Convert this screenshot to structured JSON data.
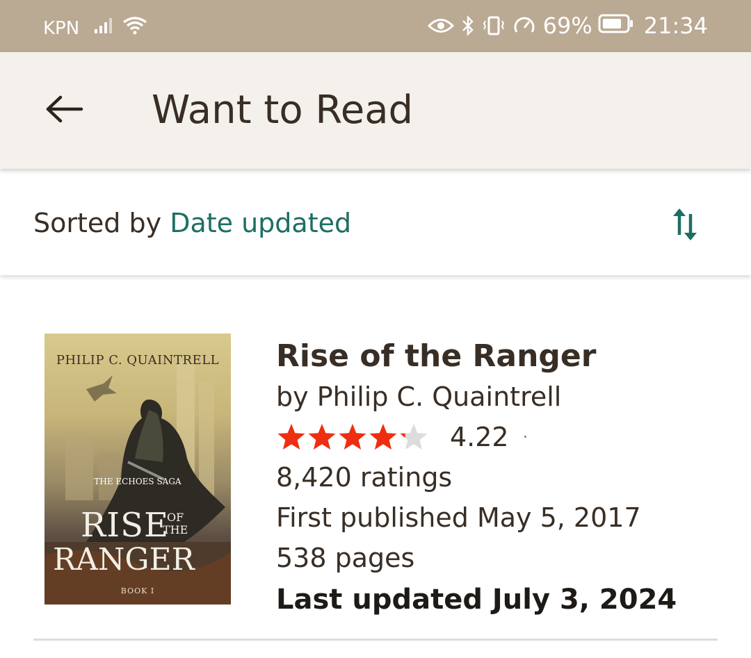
{
  "status_bar": {
    "carrier": "KPN",
    "battery_percent": "69%",
    "time": "21:34",
    "background_color": "#baa993"
  },
  "app_bar": {
    "title": "Want to Read",
    "back_icon": "arrow-back-icon"
  },
  "sort": {
    "prefix": "Sorted by",
    "value": "Date updated",
    "toggle_icon": "sort-direction-icon",
    "accent_color": "#1e6e63"
  },
  "books": [
    {
      "title": "Rise of the Ranger",
      "author_line": "by Philip C. Quaintrell",
      "rating": 4.22,
      "rating_text": "4.22",
      "rating_dot": "·",
      "star_color": "#ef2e10",
      "ratings_count": "8,420 ratings",
      "first_published": "First published May 5, 2017",
      "pages": "538 pages",
      "last_updated": "Last updated July 3, 2024",
      "cover": {
        "author": "PHILIP C. QUAINTRELL",
        "series": "THE ECHOES SAGA",
        "title_line_1": "RISE",
        "title_of": "OF",
        "title_the": "THE",
        "title_line_2": "RANGER",
        "book_number": "BOOK I"
      }
    }
  ]
}
